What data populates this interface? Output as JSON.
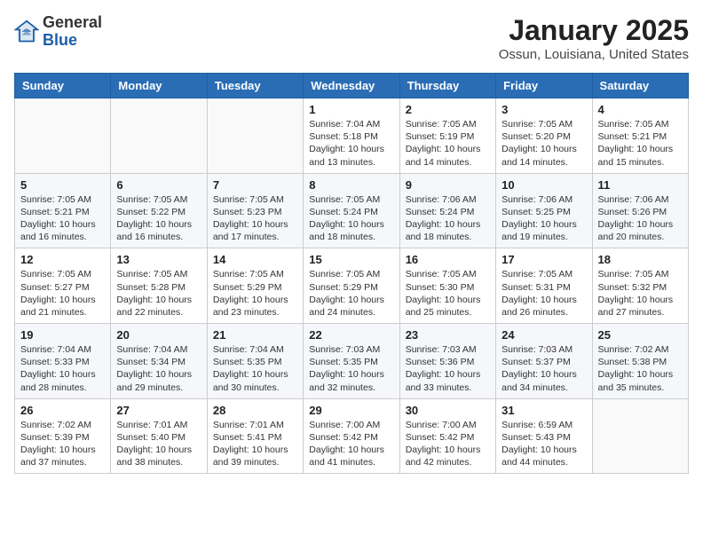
{
  "header": {
    "logo_general": "General",
    "logo_blue": "Blue",
    "month_year": "January 2025",
    "location": "Ossun, Louisiana, United States"
  },
  "weekdays": [
    "Sunday",
    "Monday",
    "Tuesday",
    "Wednesday",
    "Thursday",
    "Friday",
    "Saturday"
  ],
  "weeks": [
    [
      {
        "day": "",
        "info": ""
      },
      {
        "day": "",
        "info": ""
      },
      {
        "day": "",
        "info": ""
      },
      {
        "day": "1",
        "info": "Sunrise: 7:04 AM\nSunset: 5:18 PM\nDaylight: 10 hours\nand 13 minutes."
      },
      {
        "day": "2",
        "info": "Sunrise: 7:05 AM\nSunset: 5:19 PM\nDaylight: 10 hours\nand 14 minutes."
      },
      {
        "day": "3",
        "info": "Sunrise: 7:05 AM\nSunset: 5:20 PM\nDaylight: 10 hours\nand 14 minutes."
      },
      {
        "day": "4",
        "info": "Sunrise: 7:05 AM\nSunset: 5:21 PM\nDaylight: 10 hours\nand 15 minutes."
      }
    ],
    [
      {
        "day": "5",
        "info": "Sunrise: 7:05 AM\nSunset: 5:21 PM\nDaylight: 10 hours\nand 16 minutes."
      },
      {
        "day": "6",
        "info": "Sunrise: 7:05 AM\nSunset: 5:22 PM\nDaylight: 10 hours\nand 16 minutes."
      },
      {
        "day": "7",
        "info": "Sunrise: 7:05 AM\nSunset: 5:23 PM\nDaylight: 10 hours\nand 17 minutes."
      },
      {
        "day": "8",
        "info": "Sunrise: 7:05 AM\nSunset: 5:24 PM\nDaylight: 10 hours\nand 18 minutes."
      },
      {
        "day": "9",
        "info": "Sunrise: 7:06 AM\nSunset: 5:24 PM\nDaylight: 10 hours\nand 18 minutes."
      },
      {
        "day": "10",
        "info": "Sunrise: 7:06 AM\nSunset: 5:25 PM\nDaylight: 10 hours\nand 19 minutes."
      },
      {
        "day": "11",
        "info": "Sunrise: 7:06 AM\nSunset: 5:26 PM\nDaylight: 10 hours\nand 20 minutes."
      }
    ],
    [
      {
        "day": "12",
        "info": "Sunrise: 7:05 AM\nSunset: 5:27 PM\nDaylight: 10 hours\nand 21 minutes."
      },
      {
        "day": "13",
        "info": "Sunrise: 7:05 AM\nSunset: 5:28 PM\nDaylight: 10 hours\nand 22 minutes."
      },
      {
        "day": "14",
        "info": "Sunrise: 7:05 AM\nSunset: 5:29 PM\nDaylight: 10 hours\nand 23 minutes."
      },
      {
        "day": "15",
        "info": "Sunrise: 7:05 AM\nSunset: 5:29 PM\nDaylight: 10 hours\nand 24 minutes."
      },
      {
        "day": "16",
        "info": "Sunrise: 7:05 AM\nSunset: 5:30 PM\nDaylight: 10 hours\nand 25 minutes."
      },
      {
        "day": "17",
        "info": "Sunrise: 7:05 AM\nSunset: 5:31 PM\nDaylight: 10 hours\nand 26 minutes."
      },
      {
        "day": "18",
        "info": "Sunrise: 7:05 AM\nSunset: 5:32 PM\nDaylight: 10 hours\nand 27 minutes."
      }
    ],
    [
      {
        "day": "19",
        "info": "Sunrise: 7:04 AM\nSunset: 5:33 PM\nDaylight: 10 hours\nand 28 minutes."
      },
      {
        "day": "20",
        "info": "Sunrise: 7:04 AM\nSunset: 5:34 PM\nDaylight: 10 hours\nand 29 minutes."
      },
      {
        "day": "21",
        "info": "Sunrise: 7:04 AM\nSunset: 5:35 PM\nDaylight: 10 hours\nand 30 minutes."
      },
      {
        "day": "22",
        "info": "Sunrise: 7:03 AM\nSunset: 5:35 PM\nDaylight: 10 hours\nand 32 minutes."
      },
      {
        "day": "23",
        "info": "Sunrise: 7:03 AM\nSunset: 5:36 PM\nDaylight: 10 hours\nand 33 minutes."
      },
      {
        "day": "24",
        "info": "Sunrise: 7:03 AM\nSunset: 5:37 PM\nDaylight: 10 hours\nand 34 minutes."
      },
      {
        "day": "25",
        "info": "Sunrise: 7:02 AM\nSunset: 5:38 PM\nDaylight: 10 hours\nand 35 minutes."
      }
    ],
    [
      {
        "day": "26",
        "info": "Sunrise: 7:02 AM\nSunset: 5:39 PM\nDaylight: 10 hours\nand 37 minutes."
      },
      {
        "day": "27",
        "info": "Sunrise: 7:01 AM\nSunset: 5:40 PM\nDaylight: 10 hours\nand 38 minutes."
      },
      {
        "day": "28",
        "info": "Sunrise: 7:01 AM\nSunset: 5:41 PM\nDaylight: 10 hours\nand 39 minutes."
      },
      {
        "day": "29",
        "info": "Sunrise: 7:00 AM\nSunset: 5:42 PM\nDaylight: 10 hours\nand 41 minutes."
      },
      {
        "day": "30",
        "info": "Sunrise: 7:00 AM\nSunset: 5:42 PM\nDaylight: 10 hours\nand 42 minutes."
      },
      {
        "day": "31",
        "info": "Sunrise: 6:59 AM\nSunset: 5:43 PM\nDaylight: 10 hours\nand 44 minutes."
      },
      {
        "day": "",
        "info": ""
      }
    ]
  ]
}
